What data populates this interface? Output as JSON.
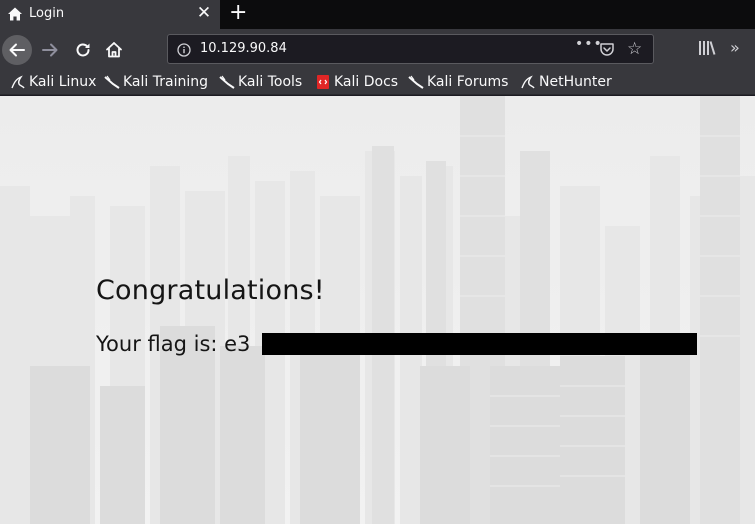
{
  "browser": {
    "tab": {
      "title": "Login",
      "icon": "home-icon"
    },
    "url": "10.129.90.84",
    "page_actions": "•••",
    "bookmarks": [
      {
        "label": "Kali Linux",
        "icon": "kali-dragon-icon"
      },
      {
        "label": "Kali Training",
        "icon": "kali-dragon-icon"
      },
      {
        "label": "Kali Tools",
        "icon": "kali-dragon-icon"
      },
      {
        "label": "Kali Docs",
        "icon": "kali-docs-icon"
      },
      {
        "label": "Kali Forums",
        "icon": "kali-dragon-icon"
      },
      {
        "label": "NetHunter",
        "icon": "nethunter-icon"
      }
    ]
  },
  "page": {
    "heading": "Congratulations!",
    "flag_label": "Your flag is: e3"
  },
  "colors": {
    "chrome_dark": "#0c0c0d",
    "chrome": "#38383d",
    "url_field": "#1c1b22",
    "page_bg": "#ececec",
    "text": "#151515",
    "redaction": "#000000"
  }
}
